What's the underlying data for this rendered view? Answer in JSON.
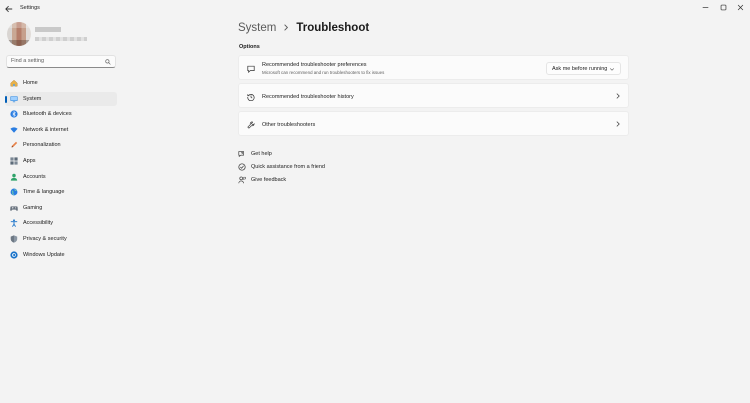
{
  "window": {
    "title": "Settings",
    "controls": {
      "minimize": "—",
      "maximize": "☐",
      "close": "✕"
    }
  },
  "search": {
    "placeholder": "Find a setting"
  },
  "sidebar": {
    "items": [
      {
        "label": "Home",
        "icon": "home-icon"
      },
      {
        "label": "System",
        "icon": "system-icon",
        "active": true
      },
      {
        "label": "Bluetooth & devices",
        "icon": "bluetooth-icon"
      },
      {
        "label": "Network & internet",
        "icon": "wifi-icon"
      },
      {
        "label": "Personalization",
        "icon": "pen-icon"
      },
      {
        "label": "Apps",
        "icon": "apps-icon"
      },
      {
        "label": "Accounts",
        "icon": "accounts-icon"
      },
      {
        "label": "Time & language",
        "icon": "globe-icon"
      },
      {
        "label": "Gaming",
        "icon": "gamepad-icon"
      },
      {
        "label": "Accessibility",
        "icon": "accessibility-icon"
      },
      {
        "label": "Privacy & security",
        "icon": "shield-icon"
      },
      {
        "label": "Windows Update",
        "icon": "update-icon"
      }
    ]
  },
  "header": {
    "parent": "System",
    "current": "Troubleshoot"
  },
  "options": {
    "heading": "Options",
    "preferences": {
      "title": "Recommended troubleshooter preferences",
      "subtitle": "Microsoft can recommend and run troubleshooters to fix issues",
      "dropdown_value": "Ask me before running"
    },
    "history": {
      "title": "Recommended troubleshooter history"
    },
    "other": {
      "title": "Other troubleshooters"
    }
  },
  "links": {
    "get_help": "Get help",
    "quick_assist": "Quick assistance from a friend",
    "feedback": "Give feedback"
  },
  "colors": {
    "accent": "#005fb8",
    "background": "#f3f3f3",
    "card": "#fbfbfb"
  }
}
